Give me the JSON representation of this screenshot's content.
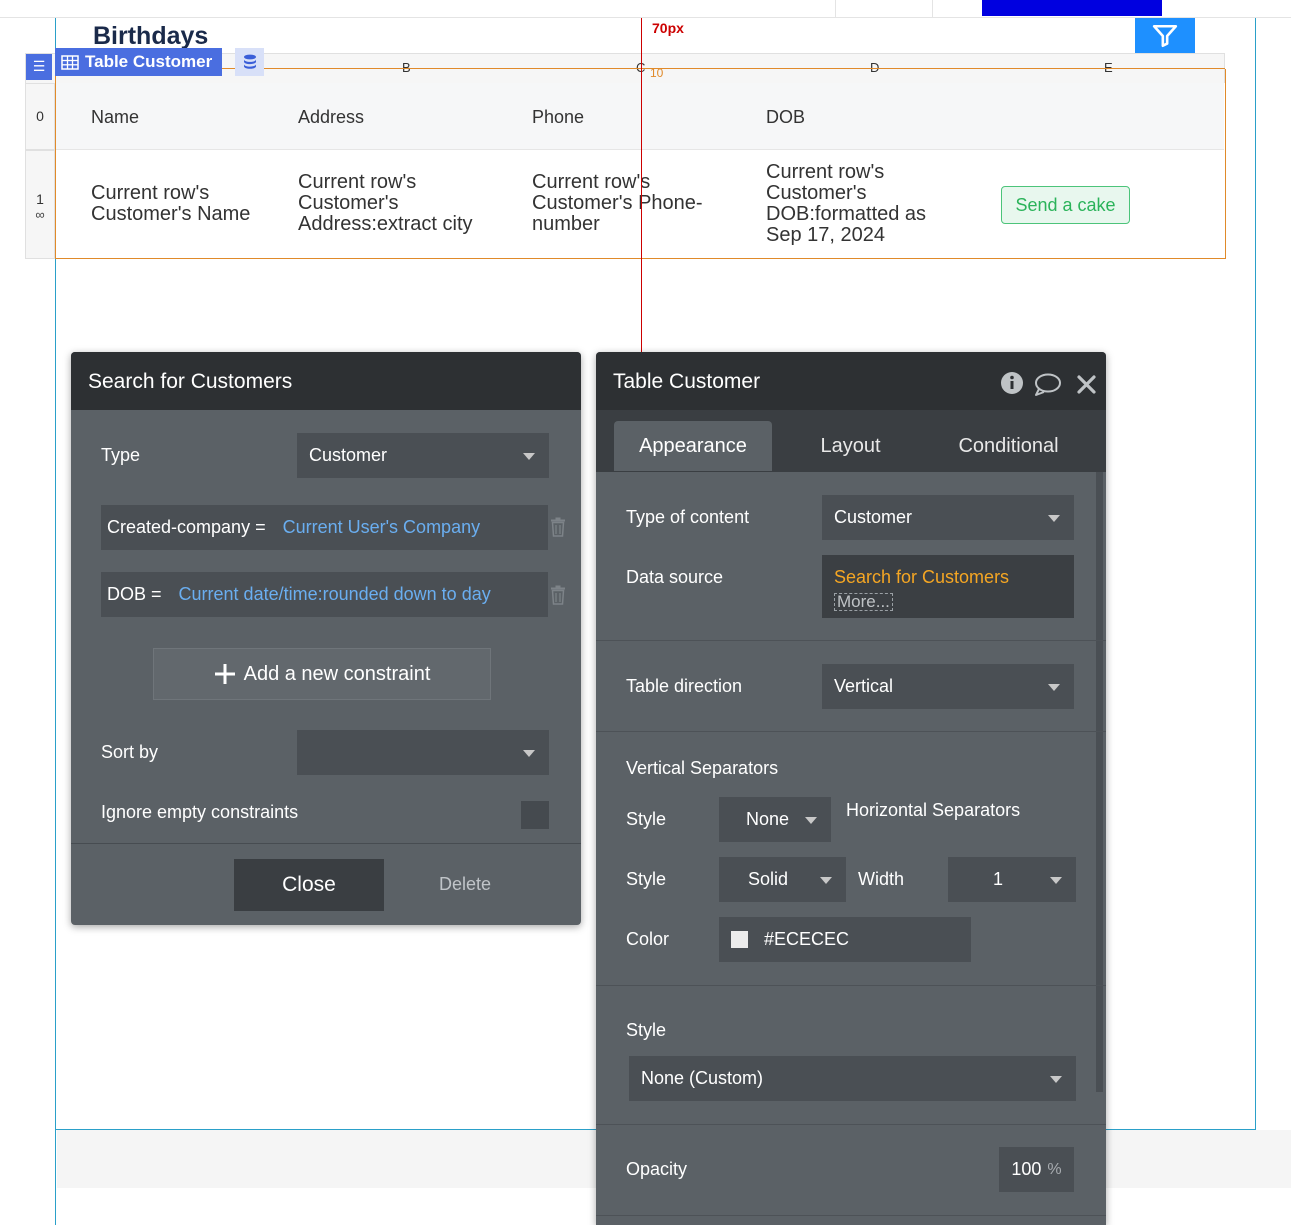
{
  "page": {
    "title": "Birthdays"
  },
  "guide": {
    "label": "70px"
  },
  "table_chip": {
    "label": "Table Customer"
  },
  "columns": {
    "letters": [
      "B",
      "C",
      "D",
      "E"
    ],
    "marker": "10"
  },
  "table": {
    "row_numbers": [
      "0",
      "1"
    ],
    "headers": [
      "Name",
      "Address",
      "Phone",
      "DOB"
    ],
    "cells": [
      [
        "Current row's",
        "Customer's Name"
      ],
      [
        "Current row's",
        "Customer's",
        "Address:extract city"
      ],
      [
        "Current row's",
        "Customer's Phone-",
        "number"
      ],
      [
        "Current row's",
        "Customer's",
        "DOB:formatted as",
        "Sep 17, 2024"
      ]
    ],
    "action_button": "Send a cake"
  },
  "search_panel": {
    "title": "Search for Customers",
    "type_label": "Type",
    "type_value": "Customer",
    "constraints": [
      {
        "field": "Created-company =",
        "value": "Current User's Company"
      },
      {
        "field": "DOB =",
        "value": "Current date/time:rounded down to day"
      }
    ],
    "add_constraint": "Add a new constraint",
    "sort_by_label": "Sort by",
    "sort_by_value": "",
    "ignore_empty_label": "Ignore empty constraints",
    "close_label": "Close",
    "delete_label": "Delete"
  },
  "props_panel": {
    "title": "Table Customer",
    "tabs": [
      "Appearance",
      "Layout",
      "Conditional"
    ],
    "active_tab": "Appearance",
    "type_of_content_label": "Type of content",
    "type_of_content_value": "Customer",
    "data_source_label": "Data source",
    "data_source_value": "Search for Customers",
    "data_source_more": "More...",
    "table_direction_label": "Table direction",
    "table_direction_value": "Vertical",
    "vertical_separators_label": "Vertical Separators",
    "horizontal_separators_label": "Horizontal Separators",
    "style_label": "Style",
    "vertical_style_value": "None",
    "horizontal_style_value": "Solid",
    "width_label": "Width",
    "width_value": "1",
    "color_label": "Color",
    "color_value": "#ECECEC",
    "style_section_label": "Style",
    "style_section_value": "None (Custom)",
    "opacity_label": "Opacity",
    "opacity_value": "100",
    "opacity_unit": "%"
  },
  "colors": {
    "panel_bg": "#5b6166",
    "panel_header": "#2d3033",
    "accent_blue": "#4a6ee0",
    "link_blue": "#6aaef0",
    "data_source_orange": "#f5a623",
    "success_green": "#2bb35a",
    "guide_red": "#cc0000"
  },
  "icons": [
    "filter-icon",
    "hamburger-icon",
    "table-icon",
    "database-icon",
    "trash-icon",
    "plus-icon",
    "info-icon",
    "comment-icon",
    "close-icon",
    "chevron-down-icon",
    "repeat-icon"
  ]
}
